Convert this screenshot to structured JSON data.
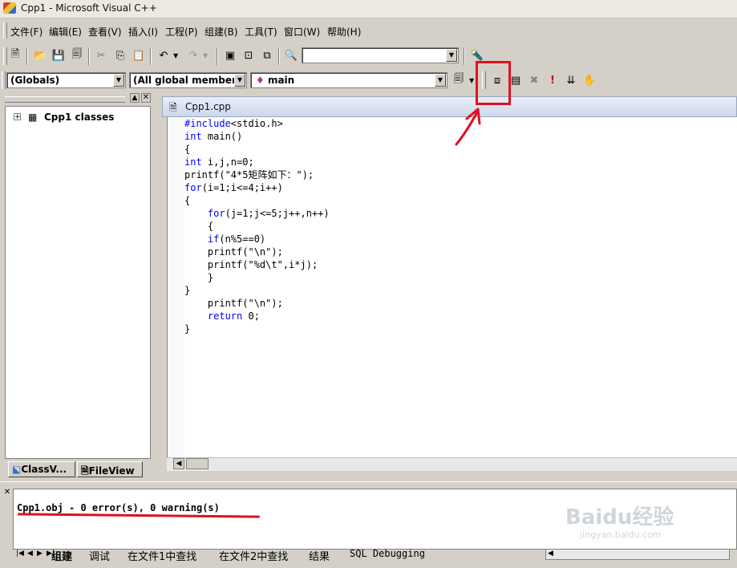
{
  "window": {
    "title": "Cpp1 - Microsoft Visual C++"
  },
  "menu": [
    "文件(F)",
    "编辑(E)",
    "查看(V)",
    "插入(I)",
    "工程(P)",
    "组建(B)",
    "工具(T)",
    "窗口(W)",
    "帮助(H)"
  ],
  "toolbar": {
    "find_value": ""
  },
  "wizardbar": {
    "scope": "(Globals)",
    "members": "(All global members",
    "function": "main"
  },
  "workspace": {
    "tree_root": "Cpp1 classes",
    "tabs": [
      "ClassV...",
      "FileView"
    ]
  },
  "editor": {
    "tab_title": "Cpp1.cpp",
    "lines": [
      "#include<stdio.h>",
      "int main()",
      "{",
      "int i,j,n=0;",
      "printf(\"4*5矩阵如下：\");",
      "for(i=1;i<=4;i++)",
      "{",
      "    for(j=1;j<=5;j++,n++)",
      "    {",
      "    if(n%5==0)",
      "    printf(\"\\n\");",
      "    printf(\"%d\\t\",i*j);",
      "    }",
      "}",
      "    printf(\"\\n\");",
      "    return 0;",
      "}"
    ]
  },
  "output": {
    "message": "Cpp1.obj - 0 error(s), 0 warning(s)",
    "tabs": [
      "组建",
      "调试",
      "在文件1中查找",
      "在文件2中查找",
      "结果",
      "SQL Debugging"
    ]
  },
  "watermark": {
    "brand": "Baidu经验",
    "url": "jingyan.baidu.com"
  },
  "colors": {
    "highlight_box": "#e01020",
    "annotation_arrow": "#e01020",
    "keyword": "#0000ff"
  }
}
